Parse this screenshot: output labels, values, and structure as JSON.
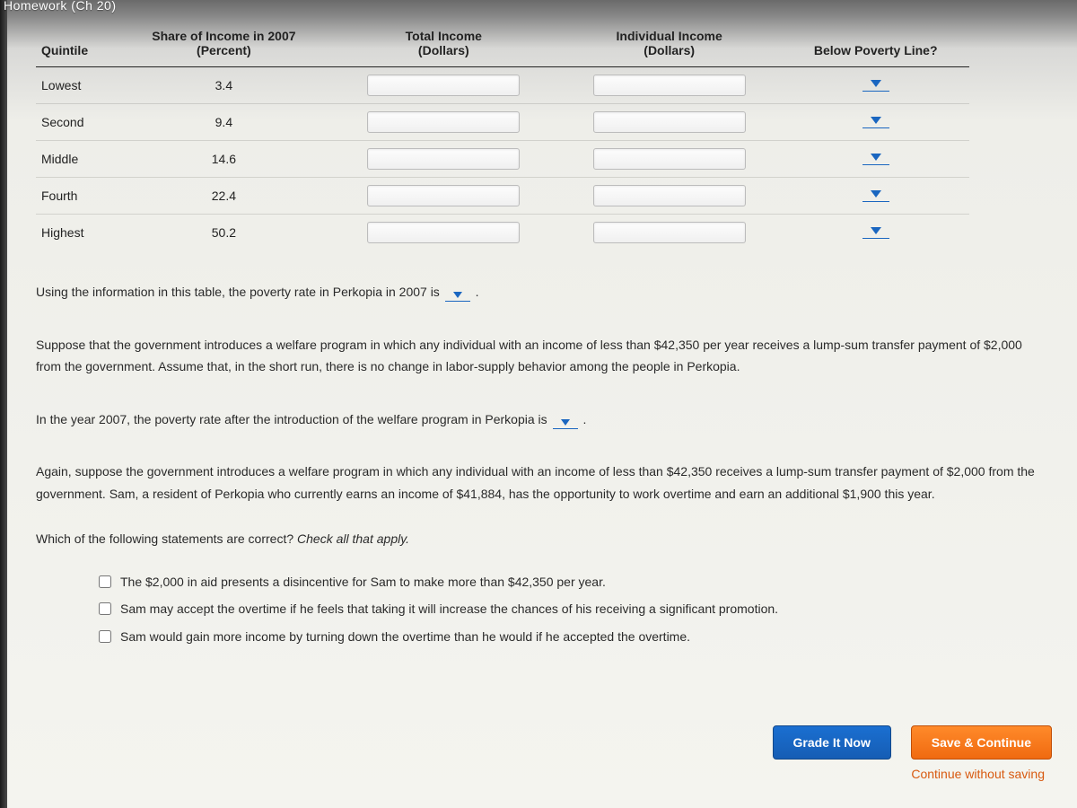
{
  "breadcrumb": "Homework (Ch 20)",
  "table": {
    "headers": {
      "quintile": "Quintile",
      "share_top": "Share of Income in 2007",
      "share_sub": "(Percent)",
      "total_top": "Total Income",
      "total_sub": "(Dollars)",
      "indiv_top": "Individual Income",
      "indiv_sub": "(Dollars)",
      "poverty": "Below Poverty Line?"
    },
    "rows": [
      {
        "quintile": "Lowest",
        "share": "3.4"
      },
      {
        "quintile": "Second",
        "share": "9.4"
      },
      {
        "quintile": "Middle",
        "share": "14.6"
      },
      {
        "quintile": "Fourth",
        "share": "22.4"
      },
      {
        "quintile": "Highest",
        "share": "50.2"
      }
    ]
  },
  "q1_pre": "Using the information in this table, the poverty rate in Perkopia in 2007 is",
  "q1_post": ".",
  "p2": "Suppose that the government introduces a welfare program in which any individual with an income of less than $42,350 per year receives a lump-sum transfer payment of $2,000 from the government. Assume that, in the short run, there is no change in labor-supply behavior among the people in Perkopia.",
  "q2_pre": "In the year 2007, the poverty rate after the introduction of the welfare program in Perkopia is",
  "q2_post": ".",
  "p3": "Again, suppose the government introduces a welfare program in which any individual with an income of less than $42,350 receives a lump-sum transfer payment of $2,000 from the government. Sam, a resident of Perkopia who currently earns an income of $41,884, has the opportunity to work overtime and earn an additional $1,900 this year.",
  "q3_stem": "Which of the following statements are correct? ",
  "q3_hint": "Check all that apply.",
  "options": [
    "The $2,000 in aid presents a disincentive for Sam to make more than $42,350 per year.",
    "Sam may accept the overtime if he feels that taking it will increase the chances of his receiving a significant promotion.",
    "Sam would gain more income by turning down the overtime than he would if he accepted the overtime."
  ],
  "buttons": {
    "grade": "Grade It Now",
    "save": "Save & Continue",
    "continue": "Continue without saving"
  }
}
